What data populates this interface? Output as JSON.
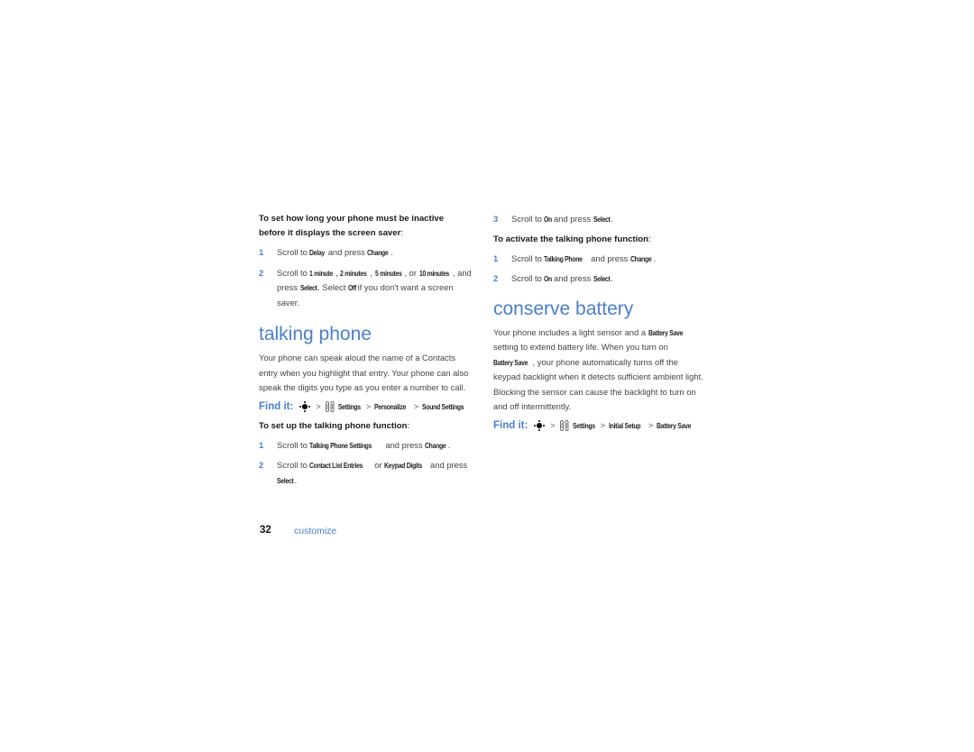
{
  "page": {
    "number": "32",
    "section": "customize",
    "accent_color": "#4a7fc8"
  },
  "left": {
    "screensaver": {
      "lead": "To set how long your phone must be inactive before it displays the screen saver",
      "steps": [
        {
          "num": "1",
          "parts": [
            "Scroll to ",
            {
              "k": "Delay"
            },
            " and press ",
            {
              "k": "Change"
            },
            "."
          ]
        },
        {
          "num": "2",
          "parts": [
            "Scroll to ",
            {
              "k": "1 minute"
            },
            ", ",
            {
              "k": "2 minutes"
            },
            ", ",
            {
              "k": "5 minutes"
            },
            ", or ",
            {
              "k": "10 minutes"
            },
            ", and press ",
            {
              "k": "Select"
            },
            ". Select ",
            {
              "k": "Off"
            },
            " if you don't want a screen saver."
          ]
        }
      ]
    },
    "talking_phone": {
      "heading": "talking phone",
      "body": "Your phone can speak aloud the name of a Contacts entry when you highlight that entry. Your phone can also speak the digits you type as you enter a number to call.",
      "find_it": {
        "label": "Find it:",
        "path": [
          "Settings",
          "Personalize",
          "Sound Settings"
        ],
        "icons": [
          "nav-key-icon",
          "settings-tools-icon"
        ]
      },
      "setup_lead": "To set up the talking phone function",
      "setup_steps": [
        {
          "num": "1",
          "parts": [
            "Scroll to ",
            {
              "k": "Talking Phone Settings"
            },
            " and press ",
            {
              "k": "Change"
            },
            "."
          ]
        },
        {
          "num": "2",
          "parts": [
            "Scroll to ",
            {
              "k": "Contact List Entries"
            },
            " or ",
            {
              "k": "Keypad Digits"
            },
            " and press ",
            {
              "k": "Select"
            },
            "."
          ]
        }
      ]
    }
  },
  "right": {
    "setup_steps_cont": [
      {
        "num": "3",
        "parts": [
          "Scroll to ",
          {
            "k": "On"
          },
          " and press ",
          {
            "k": "Select"
          },
          "."
        ]
      }
    ],
    "activate_lead": "To activate the talking phone function",
    "activate_steps": [
      {
        "num": "1",
        "parts": [
          "Scroll to ",
          {
            "k": "Talking Phone"
          },
          " and press ",
          {
            "k": "Change"
          },
          "."
        ]
      },
      {
        "num": "2",
        "parts": [
          "Scroll to ",
          {
            "k": "On"
          },
          " and press ",
          {
            "k": "Select"
          },
          "."
        ]
      }
    ],
    "conserve_battery": {
      "heading": "conserve battery",
      "body_parts": [
        "Your phone includes a light sensor and a ",
        {
          "k": "Battery Save"
        },
        " setting to extend battery life. When you turn on ",
        {
          "k": "Battery Save"
        },
        ", your phone automatically turns off the keypad backlight when it detects sufficient ambient light. Blocking the sensor can cause the backlight to turn on and off intermittently."
      ],
      "find_it": {
        "label": "Find it:",
        "path": [
          "Settings",
          "Initial Setup",
          "Battery Save"
        ],
        "icons": [
          "nav-key-icon",
          "settings-tools-icon"
        ]
      }
    }
  }
}
